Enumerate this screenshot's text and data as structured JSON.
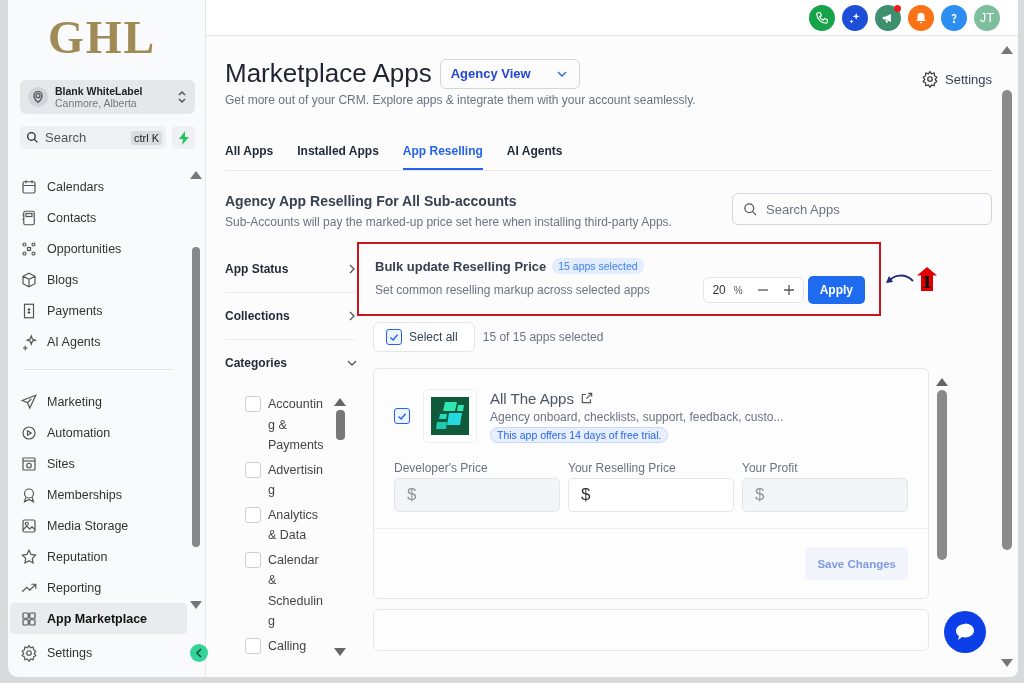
{
  "logo": "GHL",
  "account": {
    "name": "Blank WhiteLabel",
    "location": "Canmore, Alberta"
  },
  "search": {
    "placeholder": "Search",
    "shortcut": "ctrl K"
  },
  "nav_groups": [
    [
      {
        "label": "Calendars",
        "selected": false
      },
      {
        "label": "Contacts",
        "selected": false
      },
      {
        "label": "Opportunities",
        "selected": false
      },
      {
        "label": "Blogs",
        "selected": false
      },
      {
        "label": "Payments",
        "selected": false
      },
      {
        "label": "AI Agents",
        "selected": false
      }
    ],
    [
      {
        "label": "Marketing",
        "selected": false
      },
      {
        "label": "Automation",
        "selected": false
      },
      {
        "label": "Sites",
        "selected": false
      },
      {
        "label": "Memberships",
        "selected": false
      },
      {
        "label": "Media Storage",
        "selected": false
      },
      {
        "label": "Reputation",
        "selected": false
      },
      {
        "label": "Reporting",
        "selected": false
      },
      {
        "label": "App Marketplace",
        "selected": true
      }
    ]
  ],
  "sidebar_settings": "Settings",
  "avatar": "JT",
  "page": {
    "title": "Marketplace Apps",
    "view": "Agency View",
    "settings": "Settings",
    "subtitle": "Get more out of your CRM. Explore apps & integrate them with your account seamlessly."
  },
  "tabs": [
    {
      "label": "All Apps",
      "selected": false
    },
    {
      "label": "Installed Apps",
      "selected": false
    },
    {
      "label": "App Reselling",
      "selected": true
    },
    {
      "label": "AI Agents",
      "selected": false
    }
  ],
  "section": {
    "title": "Agency App Reselling For All Sub-accounts",
    "description": "Sub-Accounts will pay the marked-up price set here when installing third-party Apps.",
    "search_placeholder": "Search Apps"
  },
  "filters": [
    {
      "label": "App Status",
      "expanded": false
    },
    {
      "label": "Collections",
      "expanded": false
    },
    {
      "label": "Categories",
      "expanded": true,
      "children": [
        {
          "label": "Accounting & Payments",
          "checked": false
        },
        {
          "label": "Advertising",
          "checked": false
        },
        {
          "label": "Analytics & Data",
          "checked": false
        },
        {
          "label": "Calendar & Scheduling",
          "checked": false
        },
        {
          "label": "Calling",
          "checked": false
        }
      ]
    }
  ],
  "bulk": {
    "title": "Bulk update Reselling Price",
    "badge": "15 apps selected",
    "description": "Set common reselling markup across selected apps",
    "value": "20",
    "unit": "%",
    "apply": "Apply"
  },
  "annotation": {
    "label": "1"
  },
  "select_all": {
    "label": "Select all",
    "checked": true,
    "count": "15 of 15 apps selected"
  },
  "apps": [
    {
      "name": "All The Apps",
      "description": "Agency onboard, checklists, support, feedback, custo...",
      "trial": "This app offers 14 days of free trial.",
      "checked": true,
      "fields": [
        {
          "label": "Developer's Price",
          "prefix": "$",
          "disabled": true
        },
        {
          "label": "Your Reselling Price",
          "prefix": "$",
          "disabled": false
        },
        {
          "label": "Your Profit",
          "prefix": "$",
          "disabled": true
        }
      ],
      "save": {
        "label": "Save Changes",
        "disabled": true
      }
    }
  ]
}
